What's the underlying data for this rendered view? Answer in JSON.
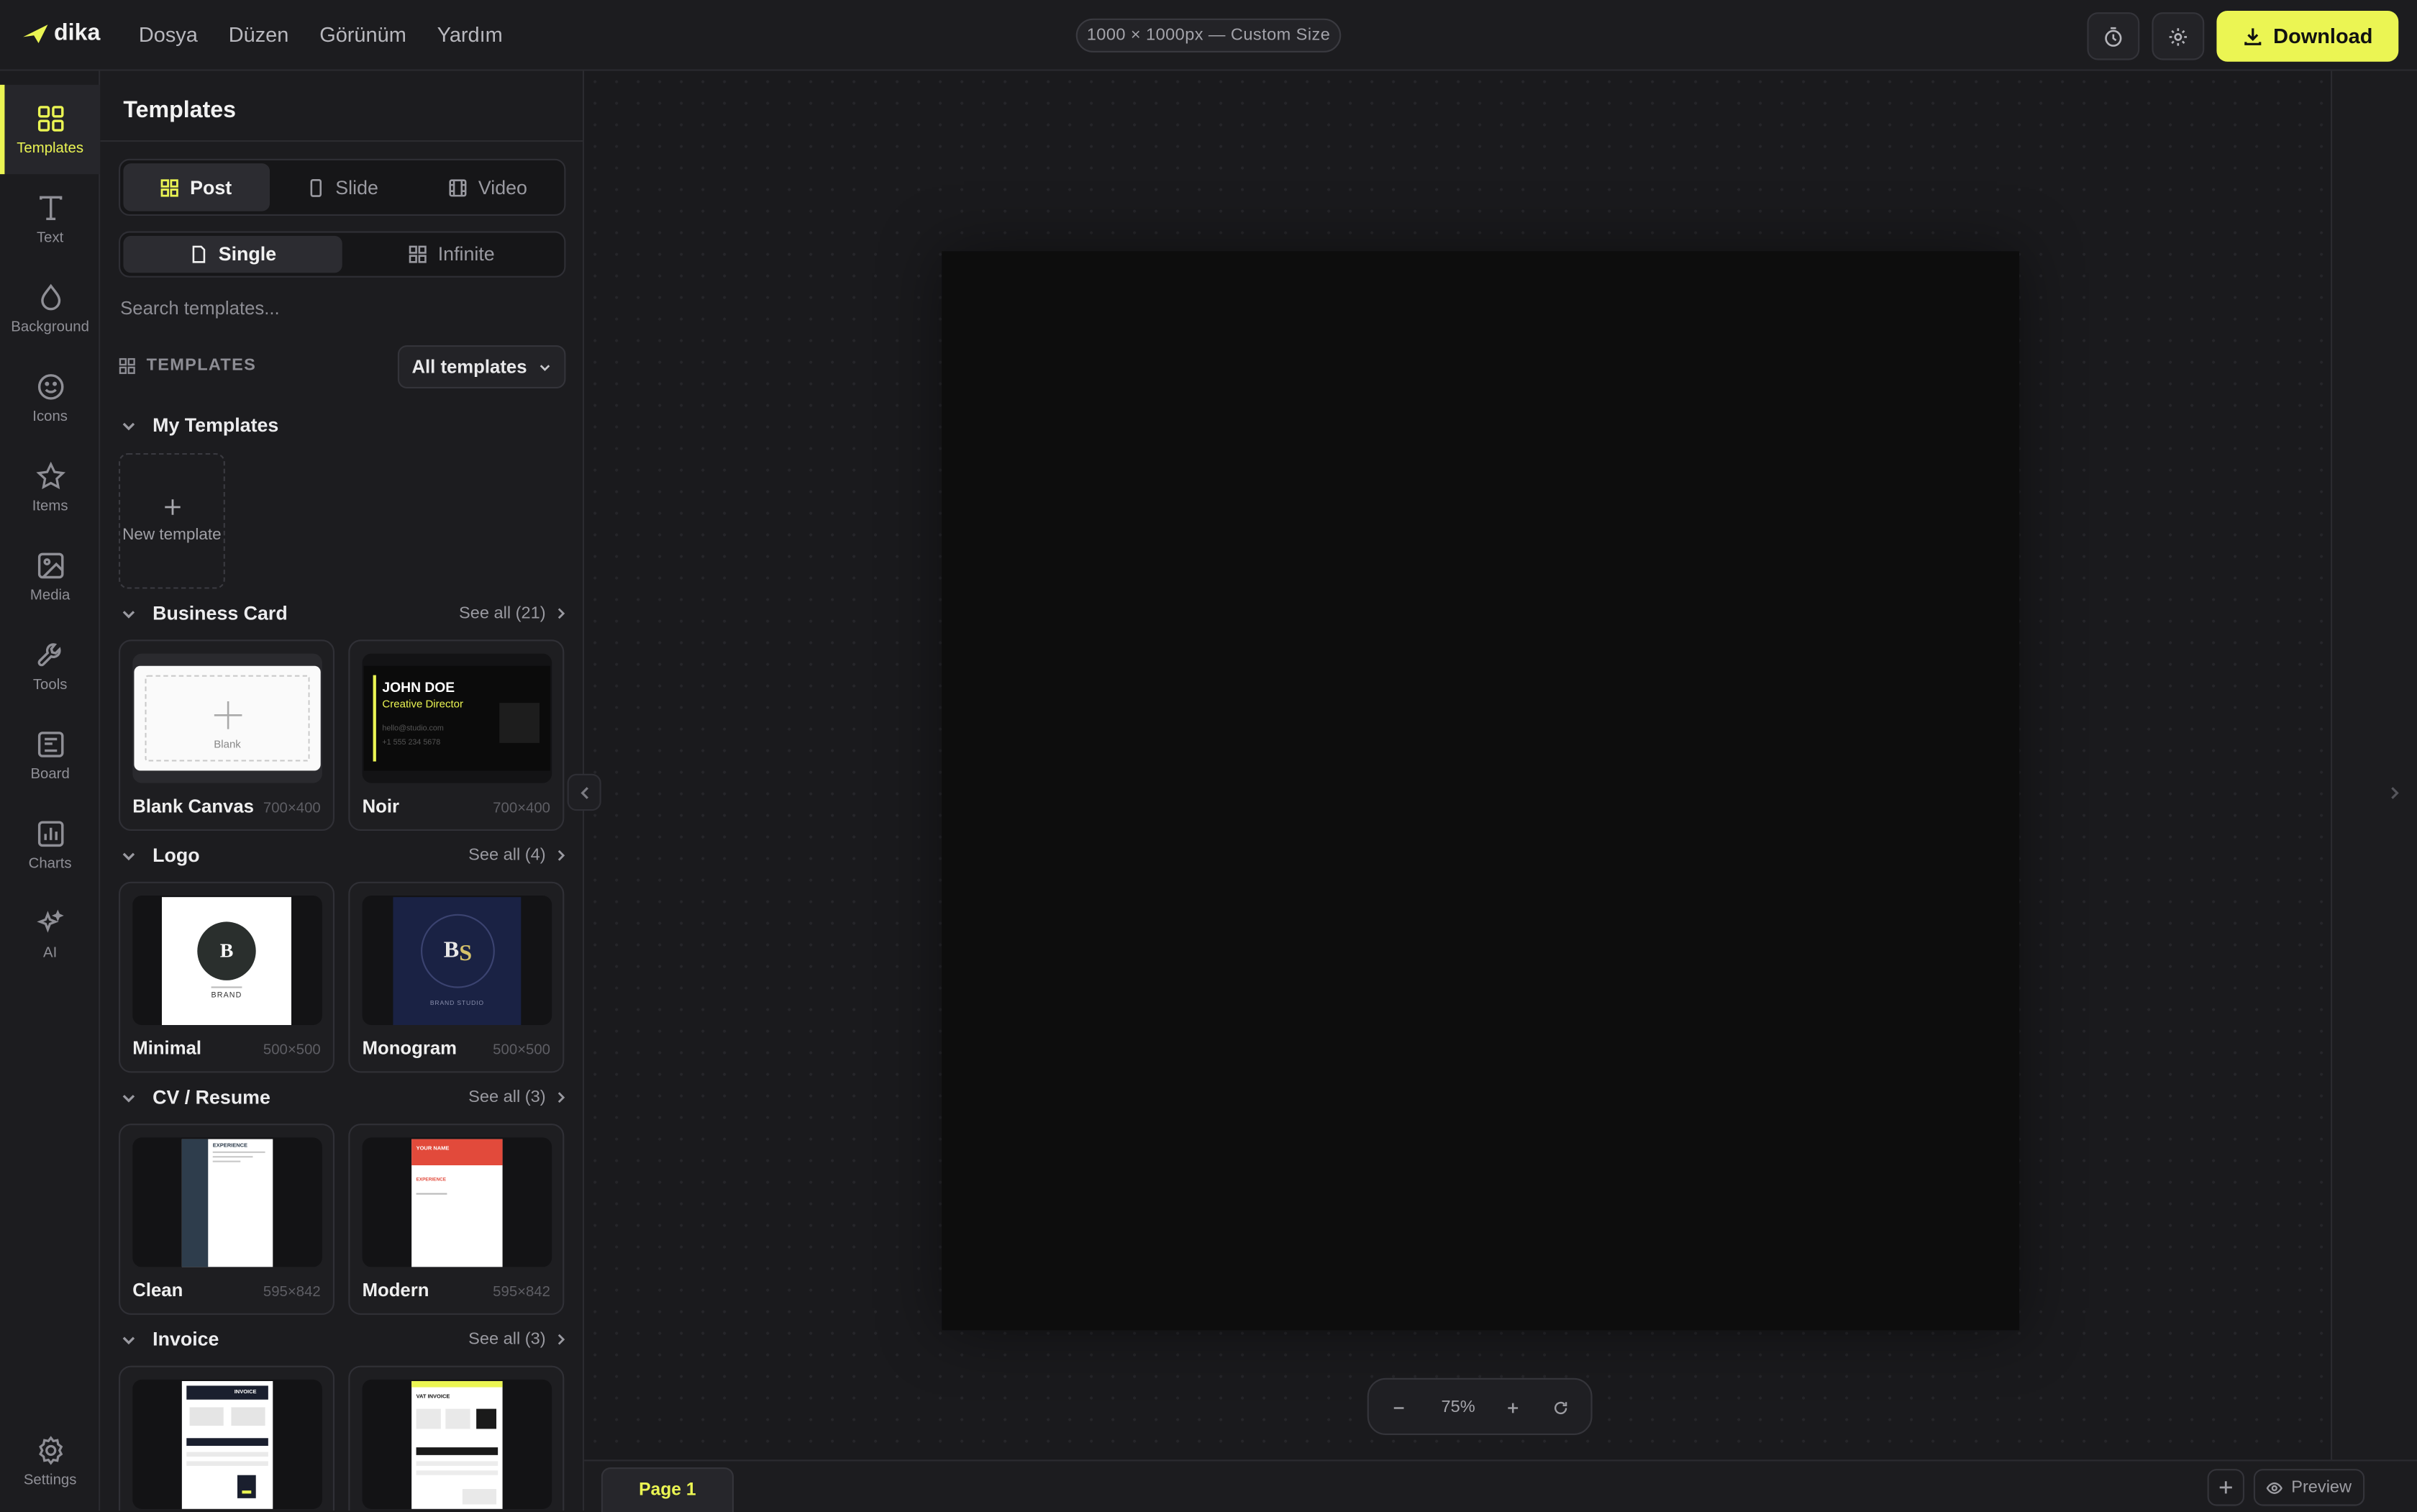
{
  "app": {
    "logo_text": "dika"
  },
  "menu": [
    "Dosya",
    "Düzen",
    "Görünüm",
    "Yardım"
  ],
  "size_label": "1000 × 1000px — Custom Size",
  "download_label": "Download",
  "rail": [
    {
      "label": "Templates",
      "icon": "layout-grid-icon"
    },
    {
      "label": "Text",
      "icon": "text-icon"
    },
    {
      "label": "Background",
      "icon": "droplet-icon"
    },
    {
      "label": "Icons",
      "icon": "smile-icon"
    },
    {
      "label": "Items",
      "icon": "star-icon"
    },
    {
      "label": "Media",
      "icon": "image-icon"
    },
    {
      "label": "Tools",
      "icon": "wrench-icon"
    },
    {
      "label": "Board",
      "icon": "board-icon"
    },
    {
      "label": "Charts",
      "icon": "chart-icon"
    },
    {
      "label": "AI",
      "icon": "sparkle-icon"
    }
  ],
  "settings_label": "Settings",
  "panel": {
    "title": "Templates",
    "format_tabs": [
      "Post",
      "Slide",
      "Video"
    ],
    "mode_tabs": [
      "Single",
      "Infinite"
    ],
    "search_placeholder": "Search templates...",
    "templates_label": "TEMPLATES",
    "filter_label": "All templates",
    "my_templates": {
      "title": "My Templates",
      "new_label": "New template"
    },
    "sections": [
      {
        "title": "Business Card",
        "see_all": "See all (21)",
        "items": [
          {
            "name": "Blank Canvas",
            "size": "700×400"
          },
          {
            "name": "Noir",
            "size": "700×400"
          }
        ]
      },
      {
        "title": "Logo",
        "see_all": "See all (4)",
        "items": [
          {
            "name": "Minimal",
            "size": "500×500"
          },
          {
            "name": "Monogram",
            "size": "500×500"
          }
        ]
      },
      {
        "title": "CV / Resume",
        "see_all": "See all (3)",
        "items": [
          {
            "name": "Clean",
            "size": "595×842"
          },
          {
            "name": "Modern",
            "size": "595×842"
          }
        ]
      },
      {
        "title": "Invoice",
        "see_all": "See all (3)",
        "items": [
          {
            "name": "",
            "size": ""
          },
          {
            "name": "",
            "size": ""
          }
        ]
      }
    ],
    "thumbs": {
      "blank_label": "Blank",
      "noir_name": "JOHN DOE",
      "noir_role": "Creative Director",
      "noir_email": "hello@studio.com",
      "noir_phone": "+1 555 234 5678",
      "minimal_letter": "B",
      "minimal_brand": "BRAND",
      "monogram_b": "B",
      "monogram_s": "S",
      "monogram_caption": "BRAND STUDIO",
      "clean_title": "EXPERIENCE",
      "modern_name": "YOUR NAME",
      "modern_section": "EXPERIENCE",
      "invoice_title": "INVOICE",
      "vat_title": "VAT INVOICE"
    }
  },
  "zoom": {
    "value": "75%"
  },
  "bottom": {
    "page_label": "Page 1",
    "preview_label": "Preview"
  },
  "colors": {
    "accent": "#ebf553",
    "background": "#1a1a1d",
    "artboard": "#0d0d0d"
  }
}
